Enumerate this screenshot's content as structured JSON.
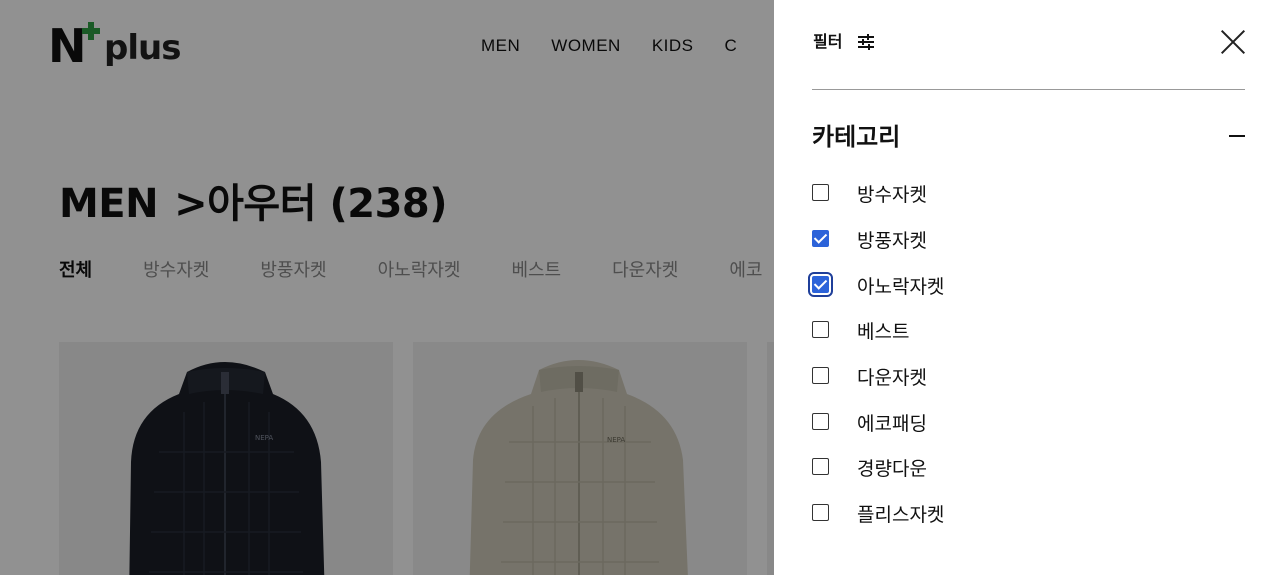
{
  "brand": {
    "logo_text": "plus",
    "accent_color": "#2f9e44"
  },
  "gnb": {
    "items": [
      "MEN",
      "WOMEN",
      "KIDS",
      "C"
    ]
  },
  "page": {
    "breadcrumb_root": "MEN",
    "breadcrumb_sep": ">",
    "category": "아우터",
    "count": "(238)"
  },
  "subtabs": [
    "전체",
    "방수자켓",
    "방풍자켓",
    "아노락자켓",
    "베스트",
    "다운자켓",
    "에코"
  ],
  "products": [
    {
      "color": "#1b1f28",
      "brand_mark": "NEPA"
    },
    {
      "color": "#cfcbba",
      "brand_mark": "NEPA"
    }
  ],
  "filter": {
    "title": "필터",
    "close_icon": "close-icon",
    "section_title": "카테고리",
    "options": [
      {
        "label": "방수자켓",
        "checked": false
      },
      {
        "label": "방풍자켓",
        "checked": true
      },
      {
        "label": "아노락자켓",
        "checked": true,
        "focused": true
      },
      {
        "label": "베스트",
        "checked": false
      },
      {
        "label": "다운자켓",
        "checked": false
      },
      {
        "label": "에코패딩",
        "checked": false
      },
      {
        "label": "경량다운",
        "checked": false
      },
      {
        "label": "플리스자켓",
        "checked": false
      }
    ],
    "checkbox_color": "#2c63d9"
  }
}
